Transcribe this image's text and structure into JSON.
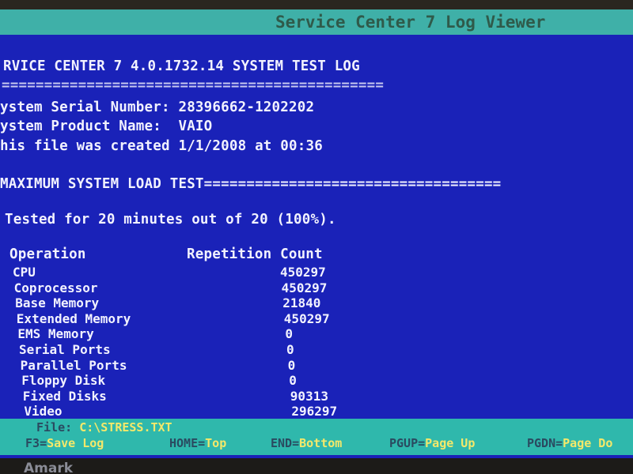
{
  "window": {
    "title": "Service Center 7 Log Viewer"
  },
  "log": {
    "heading": "RVICE CENTER 7 4.0.1732.14 SYSTEM TEST LOG",
    "separator": "=============================================",
    "serial": "ystem Serial Number: 28396662-1202202",
    "product": "ystem Product Name:  VAIO",
    "created": "his file was created 1/1/2008 at 00:36",
    "test_header": "MAXIMUM SYSTEM LOAD TEST===================================",
    "tested": "Tested for 20 minutes out of 20 (100%).",
    "progress_percent": 100,
    "columns": [
      "Operation",
      "Repetition Count"
    ],
    "rows": [
      {
        "op": "CPU",
        "count": "450297"
      },
      {
        "op": "Coprocessor",
        "count": "450297"
      },
      {
        "op": "Base Memory",
        "count": "21840"
      },
      {
        "op": "Extended Memory",
        "count": "450297"
      },
      {
        "op": "EMS Memory",
        "count": "0"
      },
      {
        "op": "Serial Ports",
        "count": "0"
      },
      {
        "op": "Parallel Ports",
        "count": "0"
      },
      {
        "op": "Floppy Disk",
        "count": "0"
      },
      {
        "op": "Fixed Disks",
        "count": "90313"
      },
      {
        "op": "Video",
        "count": "296297"
      }
    ]
  },
  "status": {
    "file_label": "File:",
    "file_value": "C:\\STRESS.TXT",
    "keys": [
      {
        "key": "F3",
        "action": "Save Log"
      },
      {
        "key": "HOME",
        "action": "Top"
      },
      {
        "key": "END",
        "action": "Bottom"
      },
      {
        "key": "PGUP",
        "action": "Page Up"
      },
      {
        "key": "PGDN",
        "action": "Page Do"
      }
    ]
  },
  "bezel": {
    "brand": "Amark"
  },
  "colors": {
    "background": "#1a22b8",
    "bar": "#3fb0a8",
    "key_value": "#f4e86a"
  }
}
